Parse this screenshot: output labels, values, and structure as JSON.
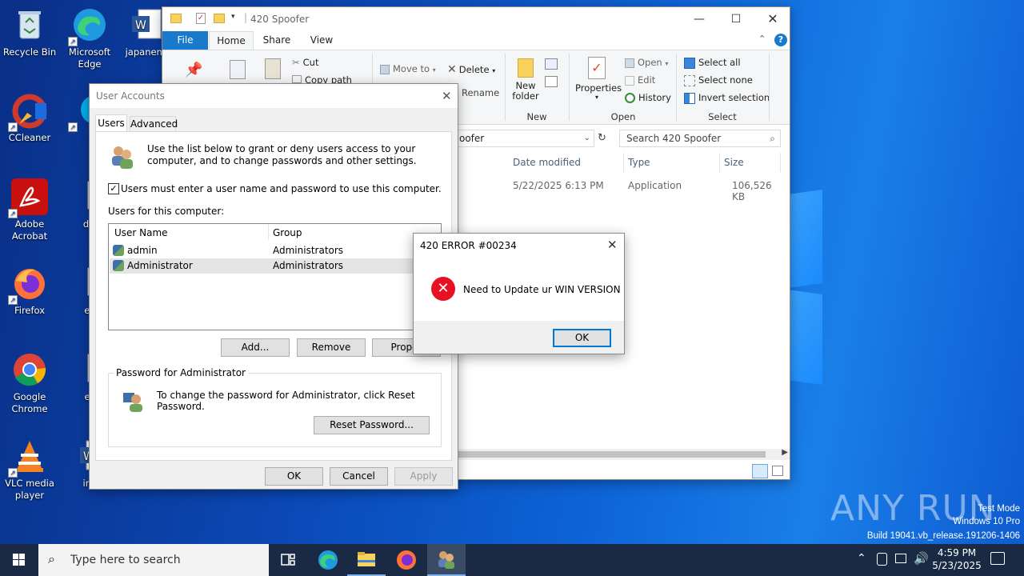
{
  "desktop": {
    "icons": [
      {
        "label": "Recycle Bin",
        "icon": "recycle-bin-icon"
      },
      {
        "label": "Microsoft Edge",
        "icon": "edge-icon"
      },
      {
        "label": "japanent",
        "icon": "word-doc-icon"
      },
      {
        "label": "CCleaner",
        "icon": "ccleaner-icon"
      },
      {
        "label": "Sky",
        "icon": "skype-icon"
      },
      {
        "label": "Adobe Acrobat",
        "icon": "acrobat-icon"
      },
      {
        "label": "details",
        "icon": "image-file-icon"
      },
      {
        "label": "Firefox",
        "icon": "firefox-icon"
      },
      {
        "label": "eleme",
        "icon": "image-file-icon"
      },
      {
        "label": "Google Chrome",
        "icon": "chrome-icon"
      },
      {
        "label": "establ",
        "icon": "image-file-icon"
      },
      {
        "label": "VLC media player",
        "icon": "vlc-icon"
      },
      {
        "label": "inputg",
        "icon": "word-doc-icon"
      }
    ],
    "watermark": {
      "brand": "ANY RUN",
      "line1": "Test Mode",
      "line2": "Windows 10 Pro",
      "line3": "Build 19041.vb_release.191206-1406"
    }
  },
  "explorer": {
    "title": "420 Spoofer",
    "tabs": [
      "File",
      "Home",
      "Share",
      "View"
    ],
    "ribbon": {
      "cut": "Cut",
      "copy_path": "Copy path",
      "move_to": "Move to",
      "delete": "Delete",
      "rename": "Rename",
      "new_folder": "New folder",
      "new_group": "New",
      "properties": "Properties",
      "open": "Open",
      "edit": "Edit",
      "history": "History",
      "open_group": "Open",
      "select_all": "Select all",
      "select_none": "Select none",
      "invert_selection": "Invert selection",
      "select_group": "Select"
    },
    "address": "oofer",
    "search_placeholder": "Search 420 Spoofer",
    "columns": [
      "Date modified",
      "Type",
      "Size"
    ],
    "rows": [
      {
        "date": "5/22/2025 6:13 PM",
        "type": "Application",
        "size": "106,526 KB"
      }
    ]
  },
  "user_accounts": {
    "title": "User Accounts",
    "tabs": [
      "Users",
      "Advanced"
    ],
    "intro": "Use the list below to grant or deny users access to your computer, and to change passwords and other settings.",
    "checkbox_label": "Users must enter a user name and password to use this computer.",
    "checkbox_checked": true,
    "list_label": "Users for this computer:",
    "columns": [
      "User Name",
      "Group"
    ],
    "users": [
      {
        "name": "admin",
        "group": "Administrators"
      },
      {
        "name": "Administrator",
        "group": "Administrators"
      }
    ],
    "buttons": {
      "add": "Add...",
      "remove": "Remove",
      "properties": "Proper"
    },
    "password_group_label": "Password for Administrator",
    "password_text": "To change the password for Administrator, click Reset Password.",
    "reset_button": "Reset Password...",
    "ok": "OK",
    "cancel": "Cancel",
    "apply": "Apply"
  },
  "error_dialog": {
    "title": "420 ERROR #00234",
    "message": "Need to Update ur WIN VERSION",
    "ok": "OK"
  },
  "taskbar": {
    "search_placeholder": "Type here to search",
    "time": "4:59 PM",
    "date": "5/23/2025"
  }
}
